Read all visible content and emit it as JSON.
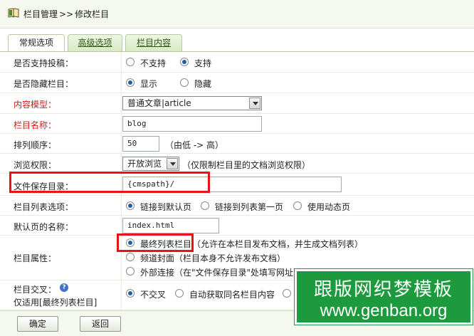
{
  "breadcrumb": {
    "root": "栏目管理",
    "sep": ">>",
    "current": "修改栏目"
  },
  "tabs": [
    {
      "label": "常规选项",
      "active": true
    },
    {
      "label": "高级选项",
      "active": false
    },
    {
      "label": "栏目内容",
      "active": false
    }
  ],
  "rows": {
    "tougao": {
      "label": "是否支持投稿：",
      "opt1": "不支持",
      "opt2": "支持",
      "selected": 2
    },
    "hidden": {
      "label": "是否隐藏栏目：",
      "opt1": "显示",
      "opt2": "隐藏",
      "selected": 1
    },
    "model": {
      "label": "内容模型：",
      "value": "普通文章|article"
    },
    "name": {
      "label": "栏目名称：",
      "value": "blog"
    },
    "order": {
      "label": "排列顺序：",
      "value": "50",
      "hint": "（由低 -> 高）"
    },
    "perm": {
      "label": "浏览权限：",
      "value": "开放浏览",
      "hint": "（仅限制栏目里的文档浏览权限）"
    },
    "dir": {
      "label": "文件保存目录：",
      "value": "{cmspath}/"
    },
    "listopt": {
      "label": "栏目列表选项：",
      "opt1": "链接到默认页",
      "opt2": "链接到列表第一页",
      "opt3": "使用动态页",
      "selected": 1
    },
    "defpage": {
      "label": "默认页的名称：",
      "value": "index.html"
    },
    "attr": {
      "label": "栏目属性：",
      "opt1": "最终列表栏目",
      "opt1_note": "（允许在本栏目发布文档，并生成文档列表）",
      "opt2": "频道封面（栏目本身不允许发布文档）",
      "opt3": "外部连接（在\"文件保存目录\"处填写网址）",
      "selected": 1
    },
    "cross": {
      "label": "栏目交叉：",
      "label2": "仅适用[最终列表栏目]",
      "opt1": "不交叉",
      "opt2": "自动获取同名栏目内容",
      "selected": 1
    }
  },
  "buttons": {
    "ok": "确定",
    "back": "返回"
  },
  "watermark": {
    "line1": "跟版网织梦模板",
    "line2": "www.genban.org"
  },
  "colors": {
    "highlight": "#e8141a",
    "watermark_bg": "#1e9a3e",
    "required_label": "#cc1a1a"
  }
}
